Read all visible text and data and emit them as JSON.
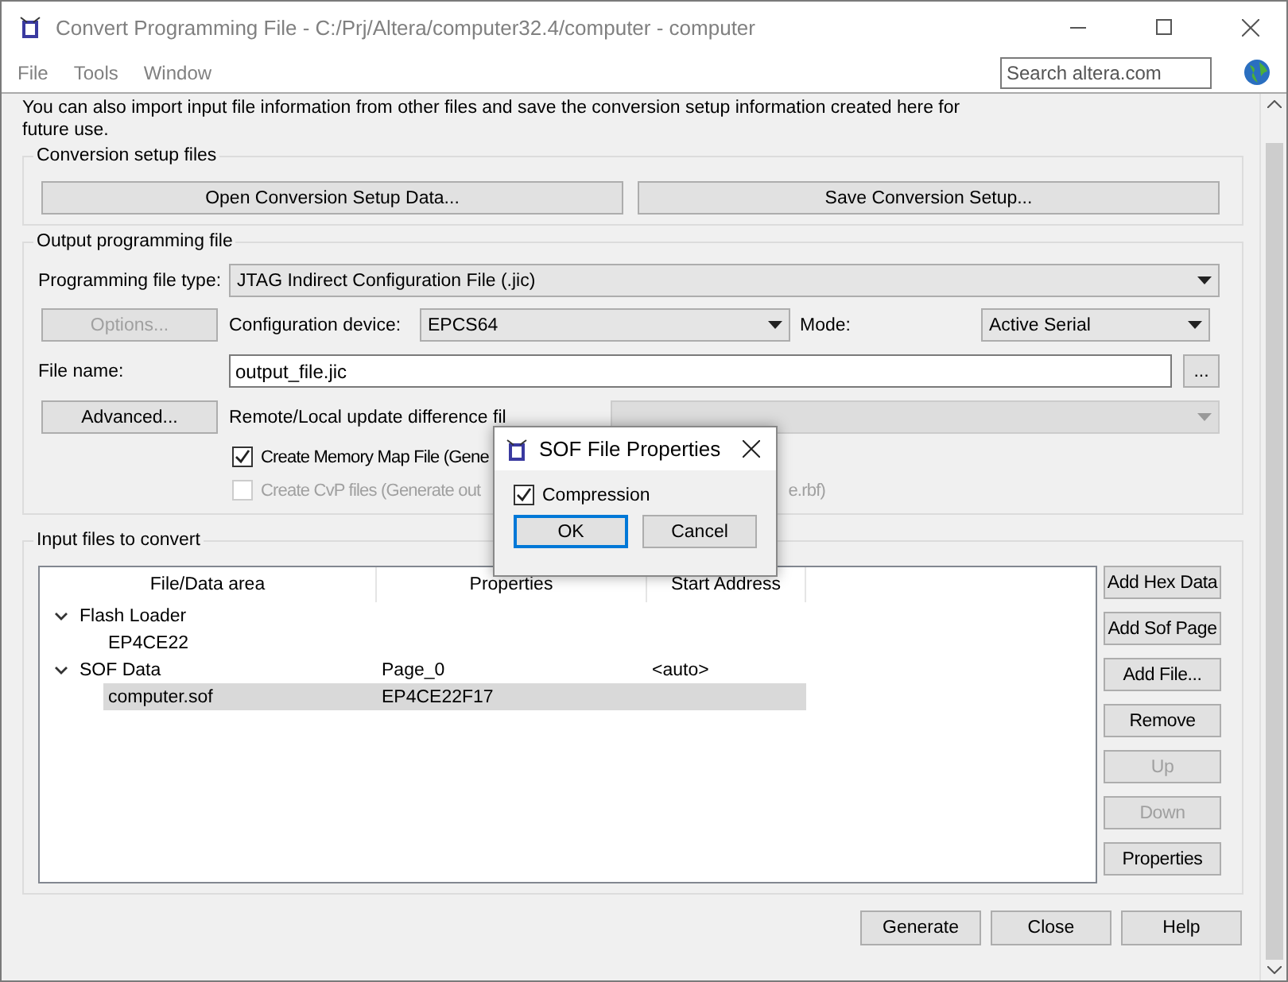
{
  "window": {
    "title": "Convert Programming File - C:/Prj/Altera/computer32.4/computer - computer"
  },
  "menu": [
    {
      "label": "File"
    },
    {
      "label": "Tools"
    },
    {
      "label": "Window"
    }
  ],
  "search": {
    "placeholder": "Search altera.com"
  },
  "intro": "You can also import input file information from other files and save the conversion setup information created here for future use.",
  "conversion_setup": {
    "title": "Conversion setup files",
    "buttons": [
      "Open Conversion Setup Data...",
      "Save Conversion Setup..."
    ]
  },
  "output": {
    "title": "Output programming file",
    "file_type": {
      "label": "Programming file type:",
      "value": "JTAG Indirect Configuration File (.jic)"
    },
    "options_button": {
      "label": "Options...",
      "disabled": true
    },
    "config_device": {
      "label": "Configuration device:",
      "value": "EPCS64"
    },
    "mode": {
      "label": "Mode:",
      "value": "Active Serial"
    },
    "file_name": {
      "label": "File name:",
      "value": "output_file.jic"
    },
    "browse_button": "...",
    "advanced_button": "Advanced...",
    "remote_label": "Remote/Local update difference fil",
    "remote_select": {
      "disabled": true
    },
    "memory_map": {
      "label": "Create Memory Map File (Gene",
      "checked": true,
      "disabled": false
    },
    "cvp": {
      "label": "Create CvP files (Generate out",
      "label_tail": "e.rbf)",
      "checked": false,
      "disabled": true
    }
  },
  "input_files": {
    "title": "Input files to convert",
    "columns": [
      "File/Data area",
      "Properties",
      "Start Address"
    ],
    "rows": [
      {
        "cells": [
          "Flash Loader"
        ],
        "expanded": true,
        "selected": false,
        "children": [
          {
            "cells": [
              "EP4CE22"
            ],
            "selected": false
          }
        ]
      },
      {
        "cells": [
          "SOF Data",
          "Page_0",
          "<auto>"
        ],
        "expanded": true,
        "selected": false,
        "children": [
          {
            "cells": [
              "computer.sof",
              "EP4CE22F17"
            ],
            "selected": true
          }
        ]
      }
    ],
    "buttons": [
      {
        "label": "Add Hex Data",
        "disabled": false
      },
      {
        "label": "Add Sof Page",
        "disabled": false
      },
      {
        "label": "Add File...",
        "disabled": false
      },
      {
        "label": "Remove",
        "disabled": false
      },
      {
        "label": "Up",
        "disabled": true
      },
      {
        "label": "Down",
        "disabled": true
      },
      {
        "label": "Properties",
        "disabled": false
      }
    ]
  },
  "footer_buttons": [
    "Generate",
    "Close",
    "Help"
  ],
  "dialog": {
    "title": "SOF File Properties",
    "compression": {
      "label": "Compression",
      "checked": true
    },
    "buttons": [
      {
        "label": "OK",
        "default": true
      },
      {
        "label": "Cancel",
        "default": false
      }
    ]
  }
}
